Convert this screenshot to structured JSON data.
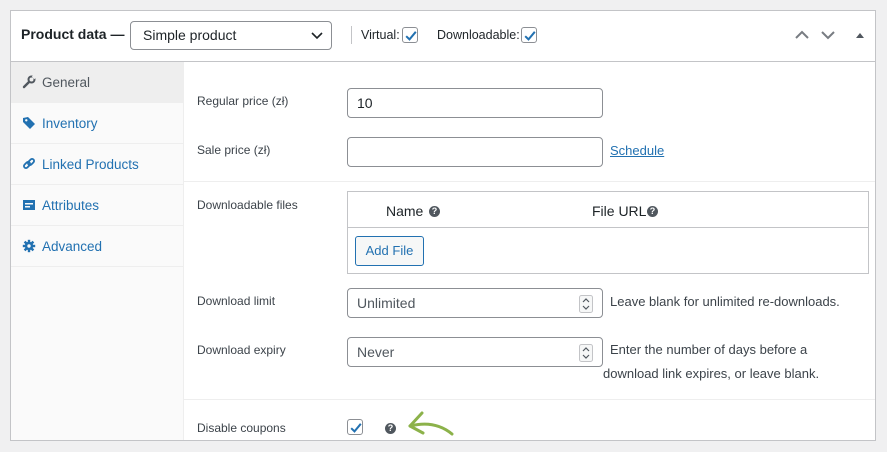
{
  "header": {
    "title": "Product data —",
    "product_type": "Simple product",
    "virtual_label": "Virtual:",
    "virtual_checked": true,
    "downloadable_label": "Downloadable:",
    "downloadable_checked": true,
    "icons": [
      "chevron-up-icon",
      "chevron-down-icon",
      "triangle-up-icon"
    ]
  },
  "sidebar": {
    "items": [
      {
        "label": "General",
        "icon": "wrench-icon",
        "active": true
      },
      {
        "label": "Inventory",
        "icon": "tag-icon",
        "active": false
      },
      {
        "label": "Linked Products",
        "icon": "link-icon",
        "active": false
      },
      {
        "label": "Attributes",
        "icon": "table-icon",
        "active": false
      },
      {
        "label": "Advanced",
        "icon": "gear-icon",
        "active": false
      }
    ]
  },
  "general": {
    "regular_price_label": "Regular price (zł)",
    "regular_price_value": "10",
    "sale_price_label": "Sale price (zł)",
    "sale_price_value": "",
    "schedule_link": "Schedule",
    "downloadable_files_label": "Downloadable files",
    "col_name": "Name",
    "col_file_url": "File URL",
    "add_file_button": "Add File",
    "download_limit_label": "Download limit",
    "download_limit_placeholder": "Unlimited",
    "download_limit_hint": "Leave blank for unlimited re-downloads.",
    "download_expiry_label": "Download expiry",
    "download_expiry_placeholder": "Never",
    "download_expiry_hint_1": "Enter the number of days before a",
    "download_expiry_hint_2": "download link expires, or leave blank.",
    "disable_coupons_label": "Disable coupons",
    "disable_coupons_checked": true
  },
  "colors": {
    "accent": "#2271b1",
    "annotation_arrow": "#8cb24a"
  }
}
